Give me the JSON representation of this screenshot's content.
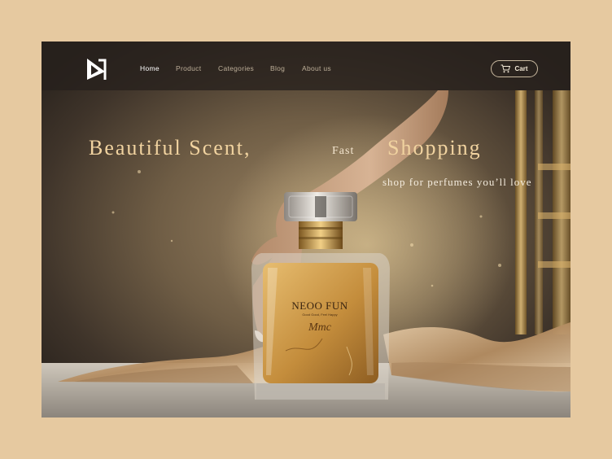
{
  "nav": {
    "links": [
      {
        "label": "Home",
        "active": true
      },
      {
        "label": "Product",
        "active": false
      },
      {
        "label": "Categories",
        "active": false
      },
      {
        "label": "Blog",
        "active": false
      },
      {
        "label": "About us",
        "active": false
      }
    ],
    "cart_label": "Cart"
  },
  "hero": {
    "headline_part1": "Beautiful Scent,",
    "headline_part2": "Fast",
    "headline_part3": "Shopping",
    "subtitle": "shop for perfumes you’ll love"
  },
  "product": {
    "brand": "NEOO FUN",
    "tagline": "Good Good, Feel Happy",
    "script": "Mmc"
  },
  "colors": {
    "page_bg": "#e6c9a0",
    "headline": "#f1d3a0",
    "liquid": "#c89a4a"
  }
}
